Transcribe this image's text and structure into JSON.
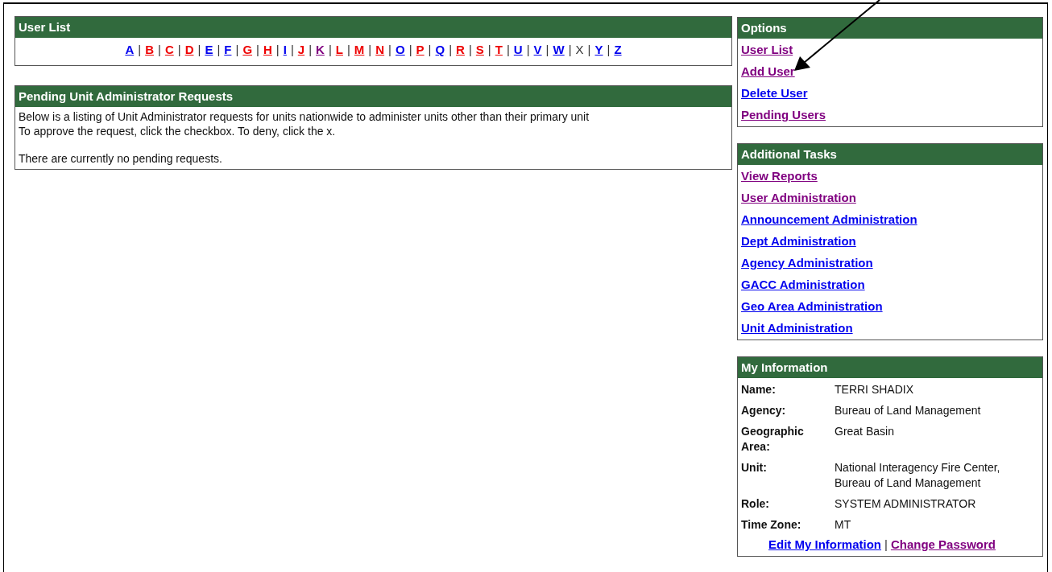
{
  "user_list": {
    "title": "User List",
    "letters": [
      {
        "label": "A",
        "link": true,
        "color": "#0000ee"
      },
      {
        "label": "B",
        "link": true,
        "color": "#ee0000"
      },
      {
        "label": "C",
        "link": true,
        "color": "#ee0000"
      },
      {
        "label": "D",
        "link": true,
        "color": "#ee0000"
      },
      {
        "label": "E",
        "link": true,
        "color": "#0000ee"
      },
      {
        "label": "F",
        "link": true,
        "color": "#0000ee"
      },
      {
        "label": "G",
        "link": true,
        "color": "#ee0000"
      },
      {
        "label": "H",
        "link": true,
        "color": "#ee0000"
      },
      {
        "label": "I",
        "link": true,
        "color": "#0000ee"
      },
      {
        "label": "J",
        "link": true,
        "color": "#ee0000"
      },
      {
        "label": "K",
        "link": true,
        "color": "#800080"
      },
      {
        "label": "L",
        "link": true,
        "color": "#ee0000"
      },
      {
        "label": "M",
        "link": true,
        "color": "#ee0000"
      },
      {
        "label": "N",
        "link": true,
        "color": "#ee0000"
      },
      {
        "label": "O",
        "link": true,
        "color": "#0000ee"
      },
      {
        "label": "P",
        "link": true,
        "color": "#ee0000"
      },
      {
        "label": "Q",
        "link": true,
        "color": "#0000ee"
      },
      {
        "label": "R",
        "link": true,
        "color": "#ee0000"
      },
      {
        "label": "S",
        "link": true,
        "color": "#ee0000"
      },
      {
        "label": "T",
        "link": true,
        "color": "#ee0000"
      },
      {
        "label": "U",
        "link": true,
        "color": "#0000ee"
      },
      {
        "label": "V",
        "link": true,
        "color": "#0000ee"
      },
      {
        "label": "W",
        "link": true,
        "color": "#0000ee"
      },
      {
        "label": "X",
        "link": false,
        "color": "#333333"
      },
      {
        "label": "Y",
        "link": true,
        "color": "#0000ee"
      },
      {
        "label": "Z",
        "link": true,
        "color": "#0000ee"
      }
    ],
    "separator": "|"
  },
  "pending": {
    "title": "Pending Unit Administrator Requests",
    "lines": [
      "Below is a listing of Unit Administrator requests for units nationwide to administer units other than their primary unit",
      "To approve the request, click the checkbox. To deny, click the x."
    ],
    "message": "There are currently no pending requests."
  },
  "options": {
    "title": "Options",
    "links": [
      {
        "label": "User List",
        "visited": true
      },
      {
        "label": "Add User",
        "visited": true
      },
      {
        "label": "Delete User",
        "visited": false
      },
      {
        "label": "Pending Users",
        "visited": true
      }
    ]
  },
  "additional_tasks": {
    "title": "Additional Tasks",
    "links": [
      {
        "label": "View Reports",
        "visited": true
      },
      {
        "label": "User Administration",
        "visited": true
      },
      {
        "label": "Announcement Administration",
        "visited": false
      },
      {
        "label": "Dept Administration",
        "visited": false
      },
      {
        "label": "Agency Administration",
        "visited": false
      },
      {
        "label": "GACC Administration",
        "visited": false
      },
      {
        "label": "Geo Area Administration",
        "visited": false
      },
      {
        "label": "Unit Administration",
        "visited": false
      }
    ]
  },
  "my_information": {
    "title": "My Information",
    "fields": [
      {
        "label": "Name:",
        "value": "TERRI SHADIX"
      },
      {
        "label": "Agency:",
        "value": "Bureau of Land Management"
      },
      {
        "label": "Geographic Area:",
        "value": "Great Basin"
      },
      {
        "label": "Unit:",
        "value": "National Interagency Fire Center, Bureau of Land Management"
      },
      {
        "label": "Role:",
        "value": "SYSTEM ADMINISTRATOR"
      },
      {
        "label": "Time Zone:",
        "value": "MT"
      }
    ],
    "links": [
      {
        "label": "Edit My Information",
        "visited": false
      },
      {
        "label": "Change Password",
        "visited": true
      }
    ],
    "separator": "|"
  }
}
